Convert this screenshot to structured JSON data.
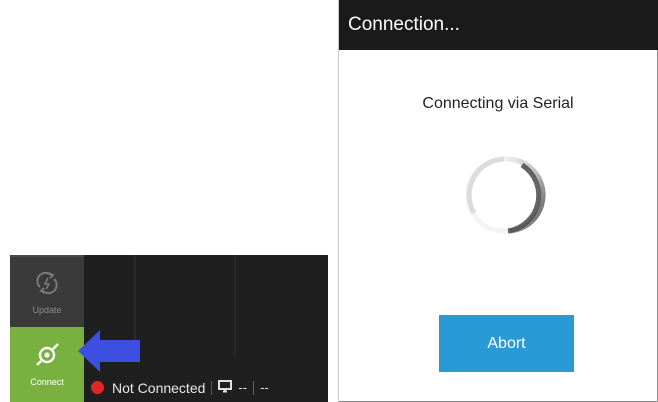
{
  "toolbar": {
    "update_label": "Update",
    "connect_label": "Connect",
    "update_icon": "update-sync-icon",
    "connect_icon": "connect-plug-icon"
  },
  "status_bar": {
    "status_text": "Not Connected",
    "status_color": "#e22626",
    "item_a": "--",
    "item_b": "--",
    "monitor_icon": "monitor-icon"
  },
  "annotation": {
    "arrow_color": "#3d4fe0"
  },
  "dialog": {
    "title": "Connection...",
    "message": "Connecting via Serial",
    "abort_label": "Abort",
    "accent_color": "#2a9ad6"
  }
}
